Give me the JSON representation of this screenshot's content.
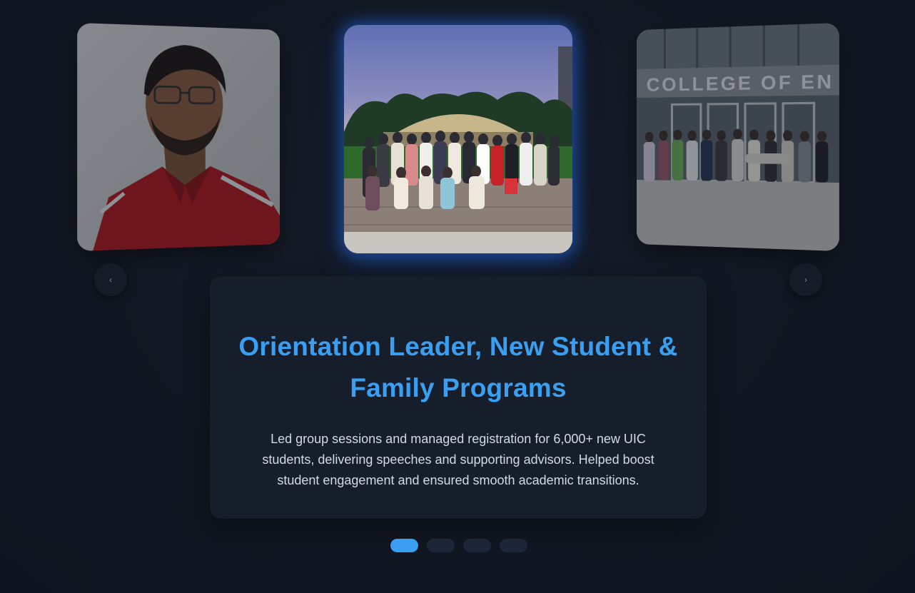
{
  "carousel": {
    "slides": [
      {
        "image": "portrait-red-polo",
        "position": "left"
      },
      {
        "image": "orientation-group-night",
        "position": "center"
      },
      {
        "image": "college-of-engineering-group",
        "position": "right"
      }
    ],
    "prev_label": "‹",
    "next_label": "›",
    "building_sign": "COLLEGE OF EN",
    "active_index": 0,
    "dot_count": 4
  },
  "card": {
    "title": "Orientation Leader, New Student & Family Programs",
    "description": "Led group sessions and managed registration for 6,000+ new UIC students, delivering speeches and supporting advisors. Helped boost student engagement and ensured smooth academic transitions."
  },
  "colors": {
    "background": "#111722",
    "accent": "#3a9ff0",
    "panel": "#161e2b",
    "dot_inactive": "#1d2636"
  }
}
